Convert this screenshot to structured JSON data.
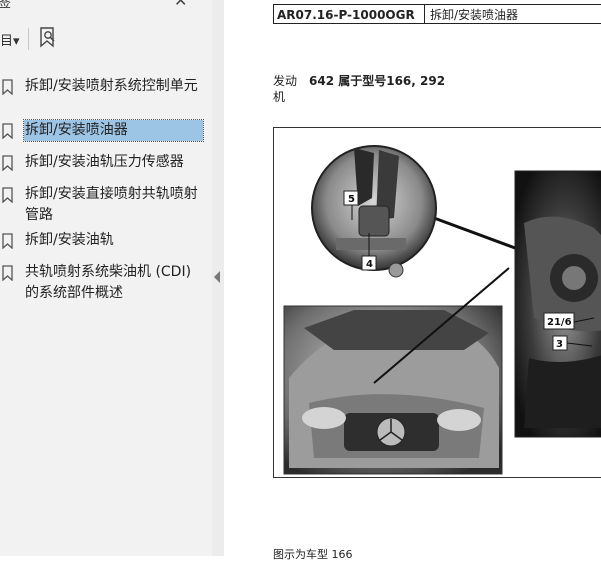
{
  "sidebar": {
    "title": "签",
    "close_label": "✕",
    "options_label": "目▾",
    "items": [
      {
        "label": "拆卸/安装喷射系统控制单元"
      },
      {
        "label": "拆卸/安装喷油器"
      },
      {
        "label": "拆卸/安装油轨压力传感器"
      },
      {
        "label": "拆卸/安装直接喷射共轨喷射管路"
      },
      {
        "label": "拆卸/安装油轨"
      },
      {
        "label": "共轨喷射系统柴油机 (CDI) 的系统部件概述"
      }
    ],
    "selected_index": 1
  },
  "document": {
    "header": {
      "code": "AR07.16-P-1000OGR",
      "name": "拆卸/安装喷油器"
    },
    "engine": {
      "prefix": "发动机",
      "text": "642 属于型号166, 292"
    },
    "figure": {
      "callouts": [
        "5",
        "4",
        "21/6",
        "3"
      ]
    },
    "caption": "图示为车型 166"
  },
  "colors": {
    "selected_bg": "#9cc4e4",
    "sidebar_bg": "#f2f2f2"
  }
}
